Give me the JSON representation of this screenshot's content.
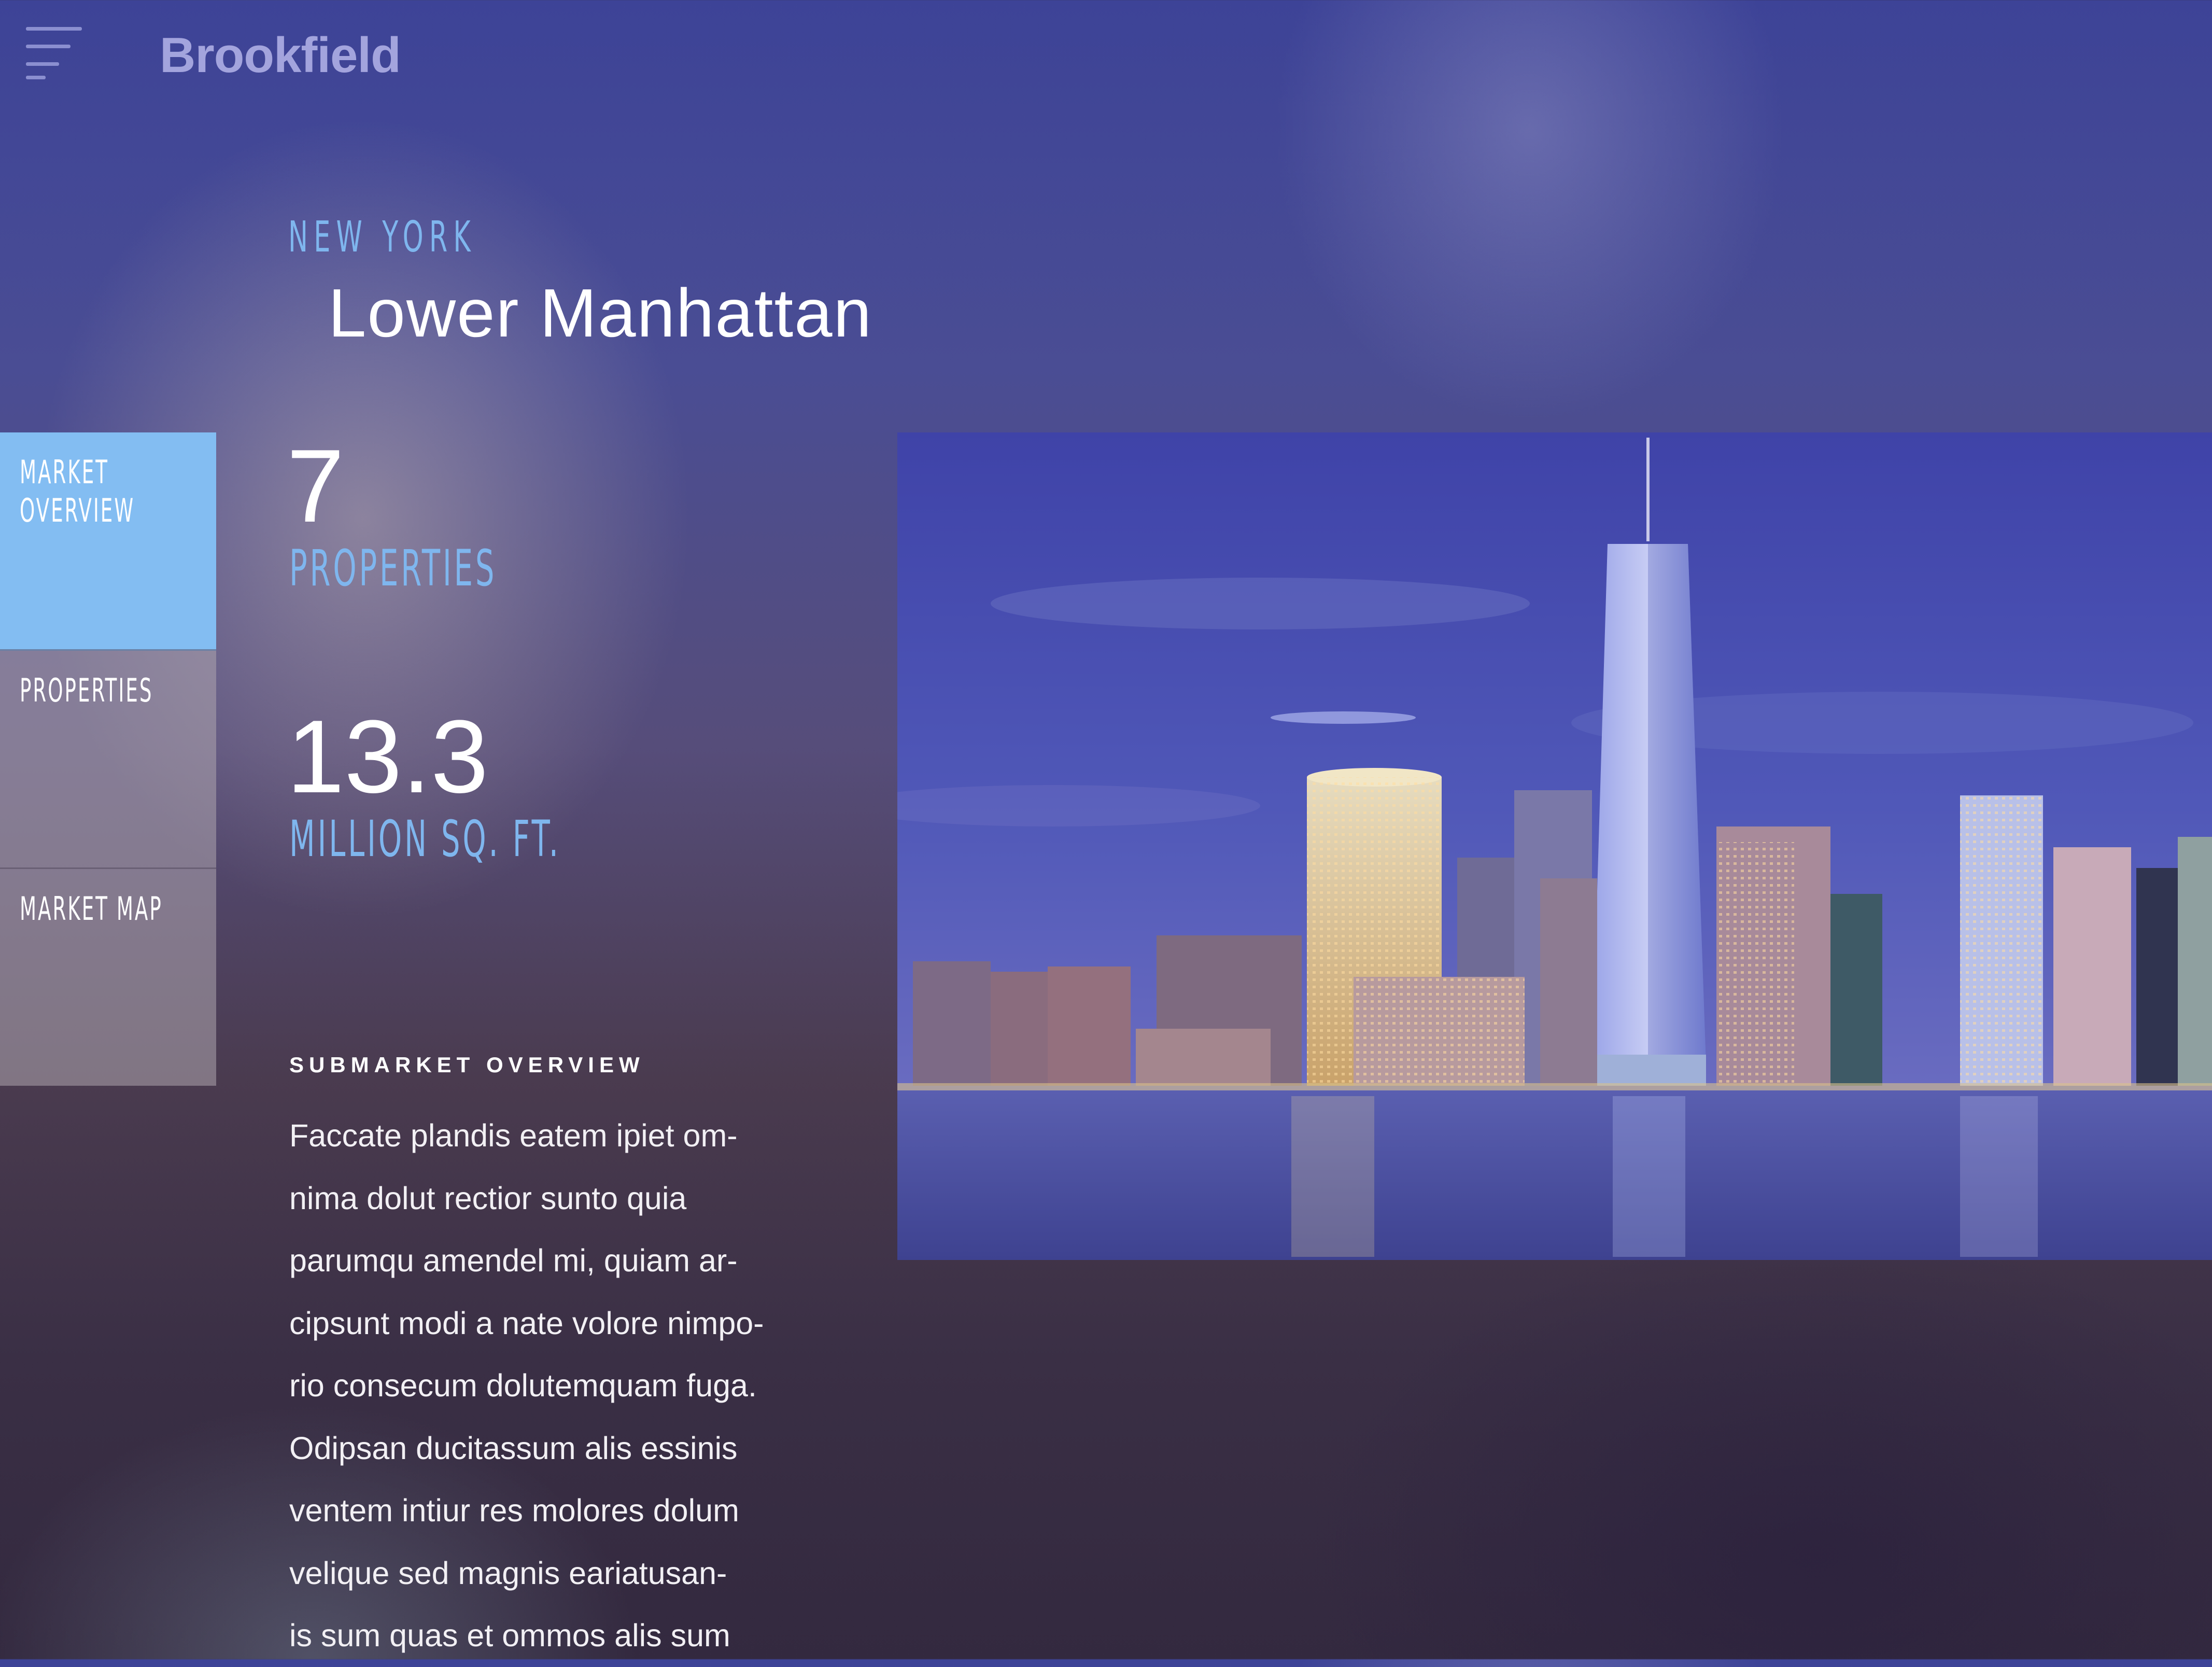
{
  "header": {
    "logo": "Brookfield",
    "menu_icon": "hamburger-menu-icon"
  },
  "location": {
    "city": "NEW YORK",
    "submarket": "Lower Manhattan"
  },
  "nav": {
    "items": [
      {
        "label": "MARKET\nOVERVIEW",
        "active": true
      },
      {
        "label": "PROPERTIES",
        "active": false
      },
      {
        "label": "MARKET MAP",
        "active": false
      }
    ]
  },
  "stats": {
    "properties_value": "7",
    "properties_label": "PROPERTIES",
    "area_value": "13.3",
    "area_label": "MILLION SQ. FT."
  },
  "overview": {
    "heading": "SUBMARKET OVERVIEW",
    "lines": [
      "Faccate plandis eatem ipiet om-",
      "nima dolut rectior sunto quia",
      "parumqu amendel mi, quiam ar-",
      "cipsunt modi a nate volore nimpo-",
      "rio consecum dolutemquam fuga.",
      "Odipsan ducitassum alis essinis",
      "ventem intiur res molores dolum",
      "velique sed magnis eariatusan-",
      "is sum quas et ommos alis sum"
    ]
  },
  "colors": {
    "accent": "#7fb6ee",
    "active_nav": "#83bdf2",
    "logo": "#a3a4dd"
  }
}
